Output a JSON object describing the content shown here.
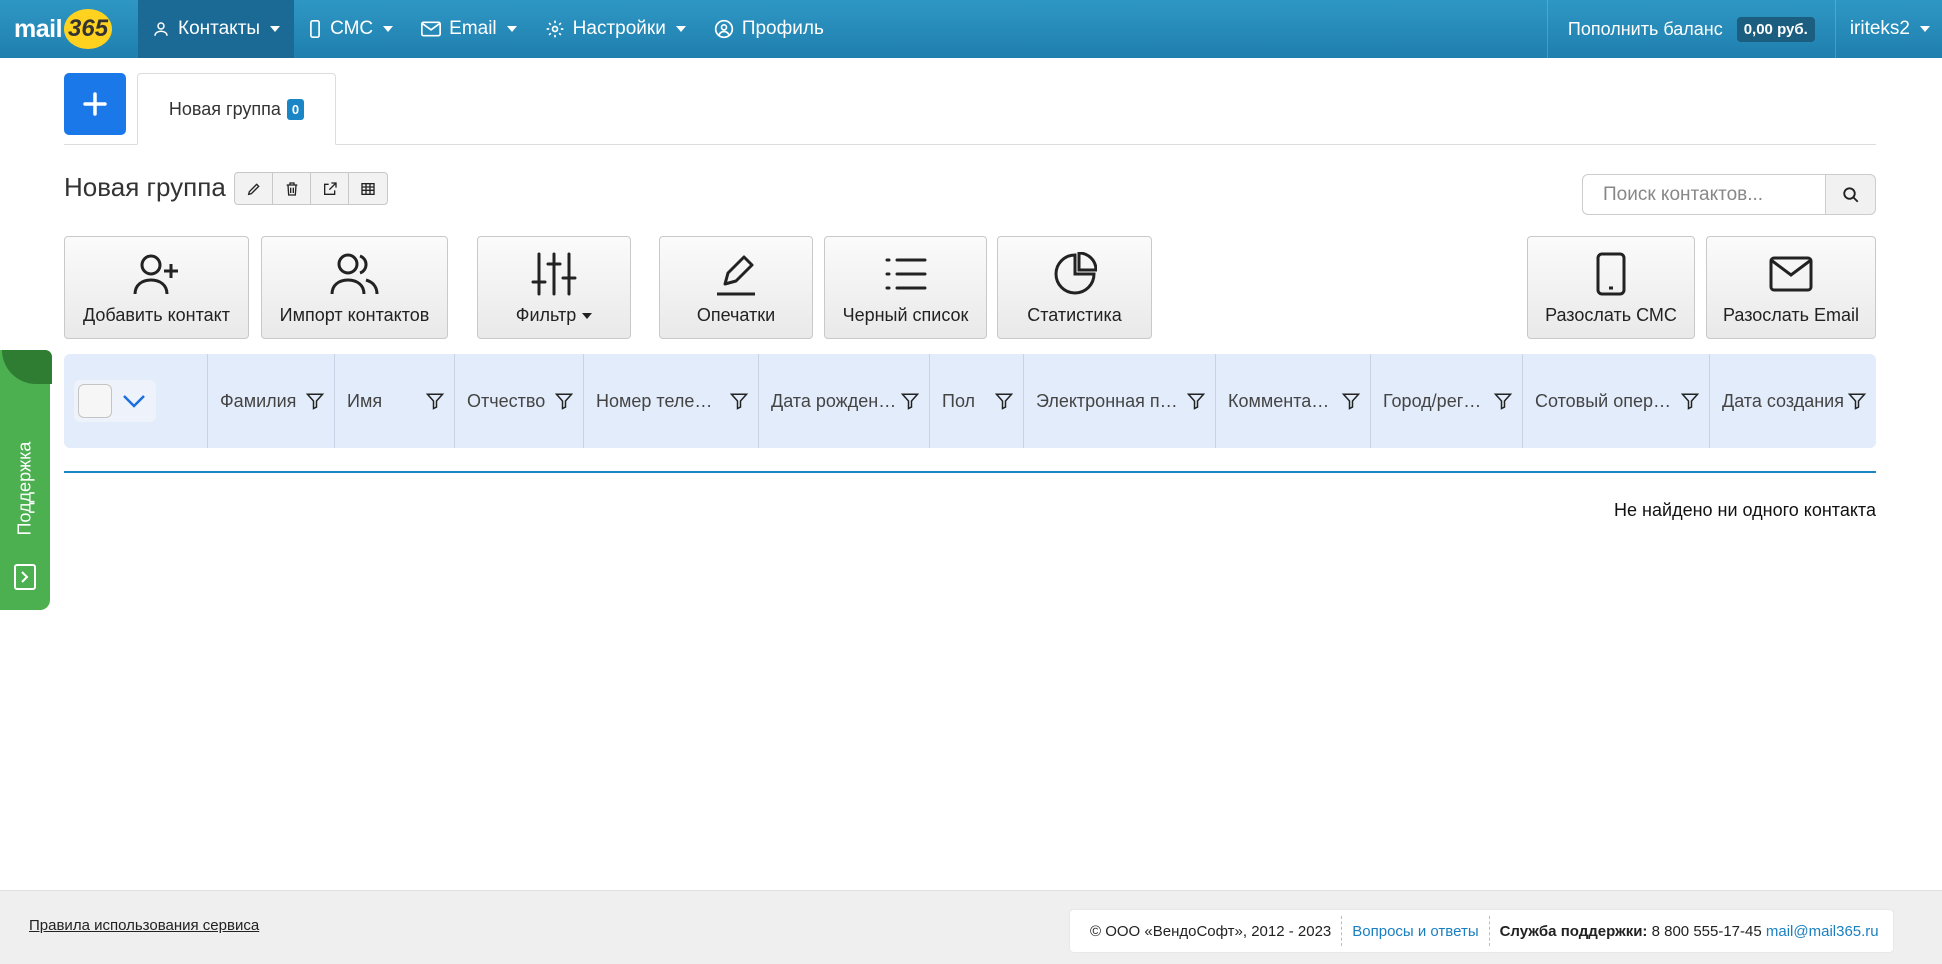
{
  "navbar": {
    "logo_text": "mail",
    "logo_number": "365",
    "items": [
      {
        "label": "Контакты",
        "icon": "person-icon",
        "dropdown": true,
        "active": true
      },
      {
        "label": "СМС",
        "icon": "phone-icon",
        "dropdown": true
      },
      {
        "label": "Email",
        "icon": "envelope-icon",
        "dropdown": true
      },
      {
        "label": "Настройки",
        "icon": "gear-icon",
        "dropdown": true
      },
      {
        "label": "Профиль",
        "icon": "user-circle-icon",
        "dropdown": false
      }
    ],
    "balance_label": "Пополнить баланс",
    "balance_value": "0,00 руб.",
    "username": "iriteks2"
  },
  "tabs": [
    {
      "label": "Новая группа",
      "count": "0",
      "active": true
    }
  ],
  "group": {
    "title": "Новая группа",
    "tools": [
      "edit-icon",
      "trash-icon",
      "external-link-icon",
      "table-icon"
    ]
  },
  "search": {
    "placeholder": "Поиск контактов..."
  },
  "actions": {
    "add_contact": "Добавить контакт",
    "import_contacts": "Импорт контактов",
    "filter": "Фильтр",
    "typos": "Опечатки",
    "blacklist": "Черный список",
    "statistics": "Статистика",
    "send_sms": "Разослать СМС",
    "send_email": "Разослать Email"
  },
  "table": {
    "columns": [
      "Фамилия",
      "Имя",
      "Отчество",
      "Номер телефона",
      "Дата рождения",
      "Пол",
      "Электронная почта",
      "Комментарий",
      "Город/регион",
      "Сотовый оператор",
      "Дата создания"
    ],
    "empty_message": "Не найдено ни одного контакта"
  },
  "support": {
    "label": "Поддержка"
  },
  "footer": {
    "rules_link": "Правила использования сервиса",
    "copyright": "© ООО «ВендоСофт», 2012 - 2023",
    "faq_link": "Вопросы и ответы",
    "support_label": "Служба поддержки:",
    "support_phone": "8 800 555-17-45",
    "support_email": "mail@mail365.ru"
  },
  "colors": {
    "navbar": "#2589ba",
    "primary_button": "#1b78e8",
    "table_header": "#e3ecfb",
    "support_tab": "#4caf50",
    "link": "#1a7fc0"
  }
}
